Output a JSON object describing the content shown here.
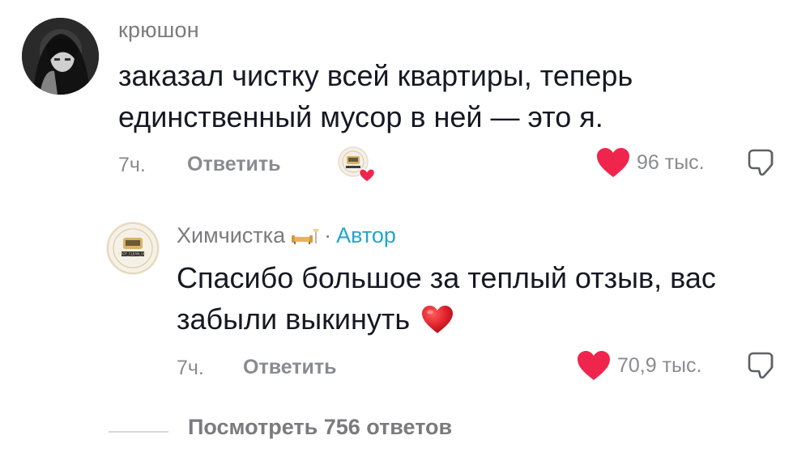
{
  "comment": {
    "username": "крюшон",
    "text": "заказал чистку всей квартиры, теперь единственный мусор в ней — это я.",
    "time": "7ч.",
    "reply_label": "Ответить",
    "likes": "96 тыс."
  },
  "reply": {
    "username": "Химчистка",
    "separator": "·",
    "author_label": "Автор",
    "text": "Спасибо большое за теплый отзыв, вас забыли выкинуть",
    "time": "7ч.",
    "reply_label": "Ответить",
    "likes": "70,9 тыс."
  },
  "view_replies": "Посмотреть 756 ответов",
  "brand_logo_text": "PROF_CLEAN_UFA",
  "icons": {
    "like": "heart-icon",
    "dislike": "thumb-down-icon",
    "creator_liked": "creator-liked-badge-icon",
    "emoji": "red-heart-emoji-icon",
    "badge": "sofa-icon"
  },
  "colors": {
    "heart": "#f0254d",
    "author": "#22a6c7",
    "muted": "#8a8b91"
  }
}
